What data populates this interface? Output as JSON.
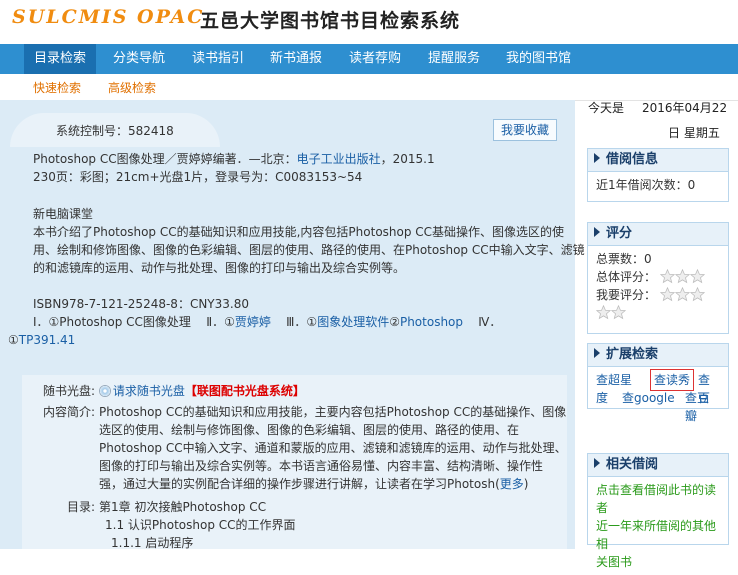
{
  "header": {
    "logo": "SULCMIS OPAC",
    "title": "五邑大学图书馆书目检索系统"
  },
  "nav": {
    "tabs": [
      "目录检索",
      "分类导航",
      "读书指引",
      "新书通报",
      "读者荐购",
      "提醒服务",
      "我的图书馆"
    ],
    "sub": [
      "快速检索",
      "高级检索"
    ]
  },
  "date": {
    "label": "今天是",
    "value": "2016年04月22",
    "weekday": "日 星期五"
  },
  "record": {
    "sys_label": "系统控制号：582418",
    "fav_button": "我要收藏",
    "title_line_a": "Photoshop CC图像处理／贾婷婷编著．—北京：",
    "publisher": "电子工业出版社",
    "title_line_b": "，2015.1",
    "physical": "230页：彩图；21cm+光盘1片，登录号为：C0083153~54",
    "series": "新电脑课堂",
    "summary_lines": [
      "本书介绍了Photoshop CC的基础知识和应用技能,内容包括Photoshop CC基础操作、图像选区的使",
      "用、绘制和修饰图像、图像的色彩编辑、图层的使用、路径的使用、在Photoshop CC中输入文字、滤镜",
      "的和滤镜库的运用、动作与批处理、图像的打印与输出及综合实例等。"
    ],
    "isbn": "ISBN978-7-121-25248-8：CNY33.80",
    "subject_i": "Ⅰ．①Photoshop CC图像处理",
    "subject_ii_prefix": "Ⅱ．①",
    "subject_ii_link": "贾婷婷",
    "subject_iii_prefix": "Ⅲ．①",
    "subject_iii_link1": "图象处理软件",
    "subject_iii_mid": "②",
    "subject_iii_link2": "Photoshop",
    "subject_iv_prefix": "Ⅳ．",
    "subject_iv_line2_prefix": "①",
    "subject_iv_link": "TP391.41"
  },
  "extra": {
    "cd_label": "随书光盘:",
    "cd_link": "请求随书光盘",
    "cd_red": "【联图配书光盘系统】",
    "intro_label": "内容简介:",
    "intro_lines": [
      "Photoshop CC的基础知识和应用技能，主要内容包括Photoshop CC的基础操作、图像",
      "选区的使用、绘制与修饰图像、图像的色彩编辑、图层的使用、路径的使用、在",
      "Photoshop CC中输入文字、通道和蒙版的应用、滤镜和滤镜库的运用、动作与批处理、",
      "图像的打印与输出及综合实例等。本书语言通俗易懂、内容丰富、结构清晰、操作性",
      "强，通过大量的实例配合详细的操作步骤进行讲解，让读者在学习Photosh"
    ],
    "more": "更多",
    "toc_label": "目录:",
    "toc_lines": [
      "第1章  初次接触Photoshop CC",
      "1.1 认识Photoshop CC的工作界面",
      "1.1.1 启动程序"
    ]
  },
  "sidebar": {
    "borrow": {
      "title": "借阅信息",
      "text": "近1年借阅次数：0"
    },
    "rating": {
      "title": "评分",
      "total": "总票数：0",
      "overall": "总体评分：",
      "mine": "我要评分："
    },
    "ext": {
      "title": "扩展检索",
      "links": [
        "查超星",
        "查读秀",
        "查百",
        "度",
        "查google",
        "查豆瓣"
      ]
    },
    "related": {
      "title": "相关借阅",
      "text_lines": [
        "点击查看借阅此书的读者",
        "近一年来所借阅的其他相",
        "关图书"
      ]
    }
  },
  "colors": {
    "nav": "#2e8fd0",
    "nav_active": "#1a6fb0",
    "link": "#1a5fa5",
    "green": "#2a9a1a",
    "red": "#d00000"
  }
}
